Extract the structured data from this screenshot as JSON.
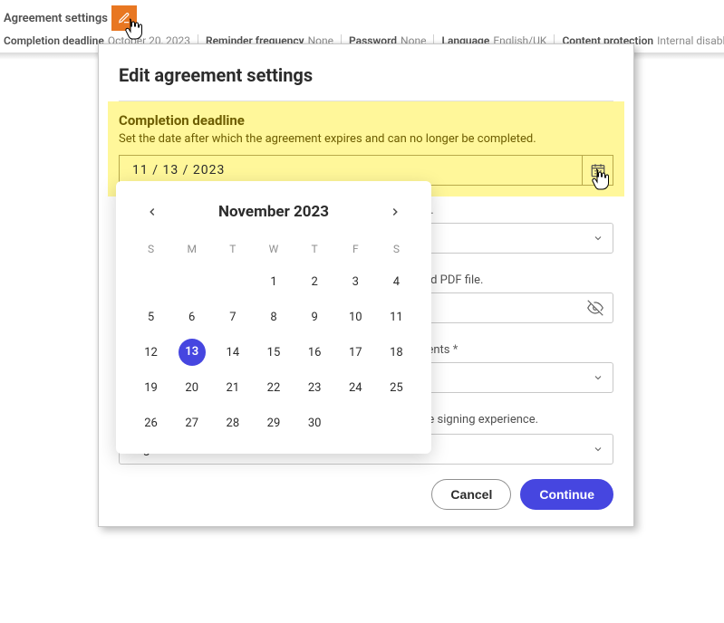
{
  "header": {
    "title": "Agreement settings",
    "meta": [
      {
        "label": "Completion deadline",
        "value": "October 20, 2023"
      },
      {
        "label": "Reminder frequency",
        "value": "None"
      },
      {
        "label": "Password",
        "value": "None"
      },
      {
        "label": "Language",
        "value": "English/UK"
      },
      {
        "label": "Content protection",
        "value": "Internal disabled & External enabled"
      }
    ]
  },
  "modal": {
    "title": "Edit agreement settings",
    "completion": {
      "title": "Completion deadline",
      "desc": "Set the date after which the agreement expires and can no longer be completed.",
      "date_display": "11 / 13 / 2023"
    },
    "frag_reminded": "ed.",
    "frag_pdf": "ned PDF file.",
    "frag_recipients": "pients",
    "frag_signing": "the signing experience.",
    "language_value": "English/UK",
    "cancel": "Cancel",
    "continue": "Continue"
  },
  "calendar": {
    "month_label": "November 2023",
    "dow": [
      "S",
      "M",
      "T",
      "W",
      "T",
      "F",
      "S"
    ],
    "leading_blanks": 3,
    "days": 30,
    "selected": 13
  }
}
